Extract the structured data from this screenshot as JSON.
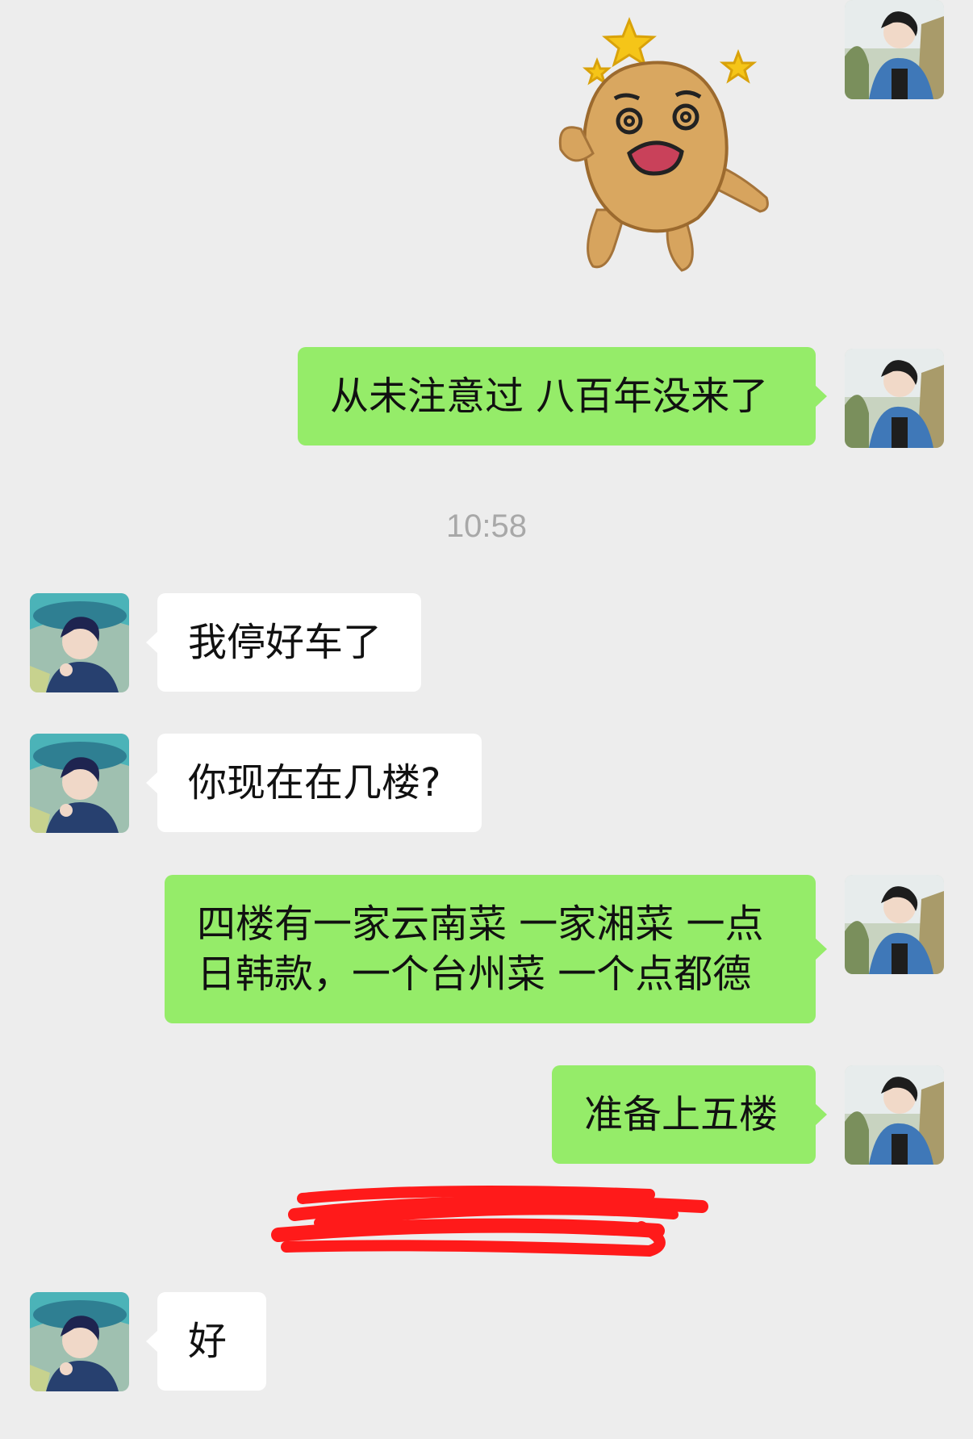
{
  "messages": [
    {
      "side": "out",
      "type": "sticker",
      "sticker": "dizzy-potato-sticker"
    },
    {
      "side": "out",
      "text": "从未注意过 八百年没来了"
    },
    {
      "type": "timestamp",
      "text": "10:58"
    },
    {
      "side": "in",
      "text": "我停好车了"
    },
    {
      "side": "in",
      "text": "你现在在几楼?"
    },
    {
      "side": "out",
      "lines": [
        "四楼有一家云南菜 一家湘菜 一点",
        "日韩款，一个台州菜 一个点都德"
      ]
    },
    {
      "side": "out",
      "text": "准备上五楼"
    },
    {
      "type": "redacted-system-note"
    },
    {
      "side": "in",
      "text": "好"
    }
  ],
  "colors": {
    "background": "#ededed",
    "outgoing_bubble": "#95ec69",
    "incoming_bubble": "#ffffff",
    "timestamp_text": "#a8a8a8",
    "redaction": "#ff1a1a"
  }
}
